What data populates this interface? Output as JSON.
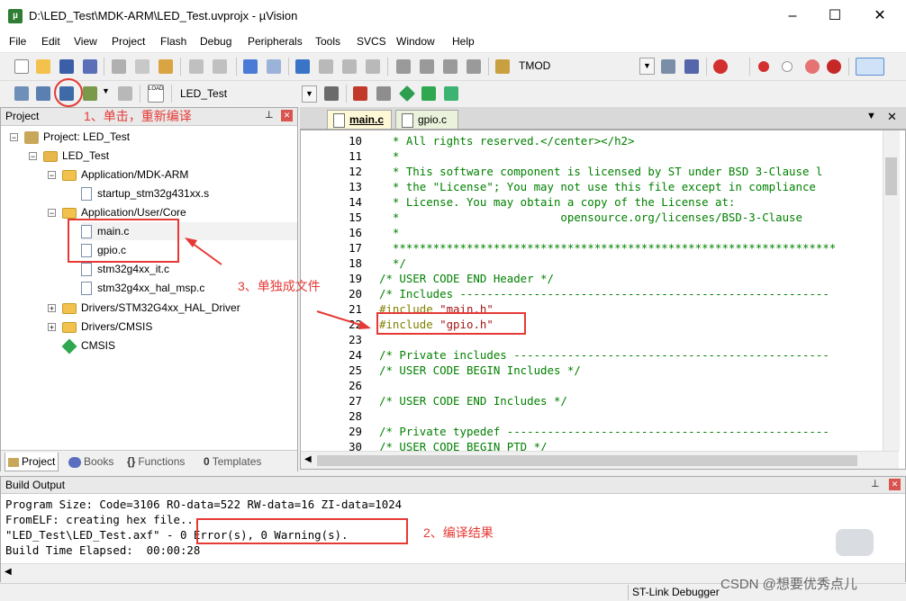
{
  "window": {
    "title": "D:\\LED_Test\\MDK-ARM\\LED_Test.uvprojx - µVision",
    "minimize": "–",
    "maximize": "☐",
    "close": "✕"
  },
  "menu": [
    "File",
    "Edit",
    "View",
    "Project",
    "Flash",
    "Debug",
    "Peripherals",
    "Tools",
    "SVCS",
    "Window",
    "Help"
  ],
  "toolbar1": {
    "find_combo_value": "TMOD"
  },
  "toolbar2": {
    "target_combo_value": "LED_Test",
    "load_label": "LOAD"
  },
  "project": {
    "header": "Project",
    "tree": {
      "root": "Project: LED_Test",
      "target": "LED_Test",
      "groups": [
        {
          "label": "Application/MDK-ARM",
          "files": [
            "startup_stm32g431xx.s"
          ]
        },
        {
          "label": "Application/User/Core",
          "files": [
            "main.c",
            "gpio.c",
            "stm32g4xx_it.c",
            "stm32g4xx_hal_msp.c"
          ]
        },
        {
          "label": "Drivers/STM32G4xx_HAL_Driver",
          "files": []
        },
        {
          "label": "Drivers/CMSIS",
          "files": []
        }
      ],
      "cmsis": "CMSIS"
    },
    "tabs": [
      "Project",
      "Books",
      "Functions",
      "Templates"
    ]
  },
  "editor": {
    "tabs": [
      "main.c",
      "gpio.c"
    ],
    "active_tab": "main.c",
    "lines": [
      {
        "n": "10",
        "text": "  * All rights reserved.</center></h2>"
      },
      {
        "n": "11",
        "text": "  *"
      },
      {
        "n": "12",
        "text": "  * This software component is licensed by ST under BSD 3-Clause l"
      },
      {
        "n": "13",
        "text": "  * the \"License\"; You may not use this file except in compliance"
      },
      {
        "n": "14",
        "text": "  * License. You may obtain a copy of the License at:"
      },
      {
        "n": "15",
        "text": "  *                        opensource.org/licenses/BSD-3-Clause"
      },
      {
        "n": "16",
        "text": "  *"
      },
      {
        "n": "17",
        "text": "  ******************************************************************"
      },
      {
        "n": "18",
        "text": "  */"
      },
      {
        "n": "19",
        "text": "/* USER CODE END Header */"
      },
      {
        "n": "20",
        "text": "/* Includes -------------------------------------------------------"
      },
      {
        "n": "21",
        "text": "#include \"main.h\""
      },
      {
        "n": "22",
        "text": "#include \"gpio.h\""
      },
      {
        "n": "23",
        "text": ""
      },
      {
        "n": "24",
        "text": "/* Private includes -----------------------------------------------"
      },
      {
        "n": "25",
        "text": "/* USER CODE BEGIN Includes */"
      },
      {
        "n": "26",
        "text": ""
      },
      {
        "n": "27",
        "text": "/* USER CODE END Includes */"
      },
      {
        "n": "28",
        "text": ""
      },
      {
        "n": "29",
        "text": "/* Private typedef ------------------------------------------------"
      },
      {
        "n": "30",
        "text": "/* USER CODE BEGIN PTD */"
      }
    ]
  },
  "build_output": {
    "header": "Build Output",
    "lines": [
      "Program Size: Code=3106 RO-data=522 RW-data=16 ZI-data=1024",
      "FromELF: creating hex file...",
      "\"LED_Test\\LED_Test.axf\" - 0 Error(s), 0 Warning(s).",
      "Build Time Elapsed:  00:00:28"
    ]
  },
  "status": {
    "debugger": "ST-Link Debugger"
  },
  "annotations": {
    "step1": "1、单击，重新编译",
    "step2": "2、编译结果",
    "step3": "3、单独成文件",
    "watermark": "CSDN @想要优秀点儿"
  },
  "colors": {
    "annotation": "#e53935",
    "comment": "#008000",
    "preprocessor": "#808000",
    "string": "#a31515"
  }
}
